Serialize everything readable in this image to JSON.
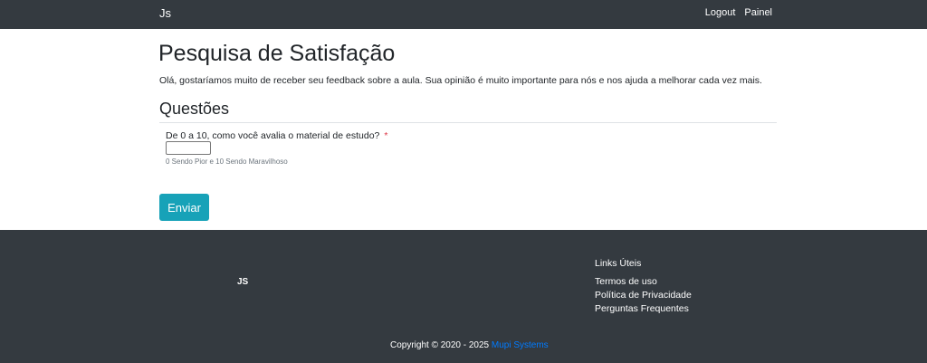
{
  "navbar": {
    "brand": "Js",
    "links": [
      {
        "label": "Logout"
      },
      {
        "label": "Painel"
      }
    ]
  },
  "main": {
    "title": "Pesquisa de Satisfação",
    "intro": "Olá, gostaríamos muito de receber seu feedback sobre a aula. Sua opinião é muito importante para nós e nos ajuda a melhorar cada vez mais.",
    "section_title": "Questões",
    "question": {
      "label": "De 0 a 10, como você avalia o material de estudo?",
      "required_marker": "*",
      "value": "",
      "help": "0 Sendo Pior e 10 Sendo Maravilhoso"
    },
    "submit_label": "Enviar"
  },
  "footer": {
    "brand": "JS",
    "links_heading": "Links Úteis",
    "links": [
      {
        "label": "Termos de uso"
      },
      {
        "label": "Política de Privacidade"
      },
      {
        "label": "Perguntas Frequentes"
      }
    ],
    "copyright_prefix": "Copyright © 2020 - 2025",
    "company": "Mupi Systems"
  },
  "colors": {
    "navbar_bg": "#343a40",
    "footer_bg": "#343a40",
    "button_bg": "#17a2b8",
    "link_accent": "#007bff",
    "required": "#dc3545"
  }
}
